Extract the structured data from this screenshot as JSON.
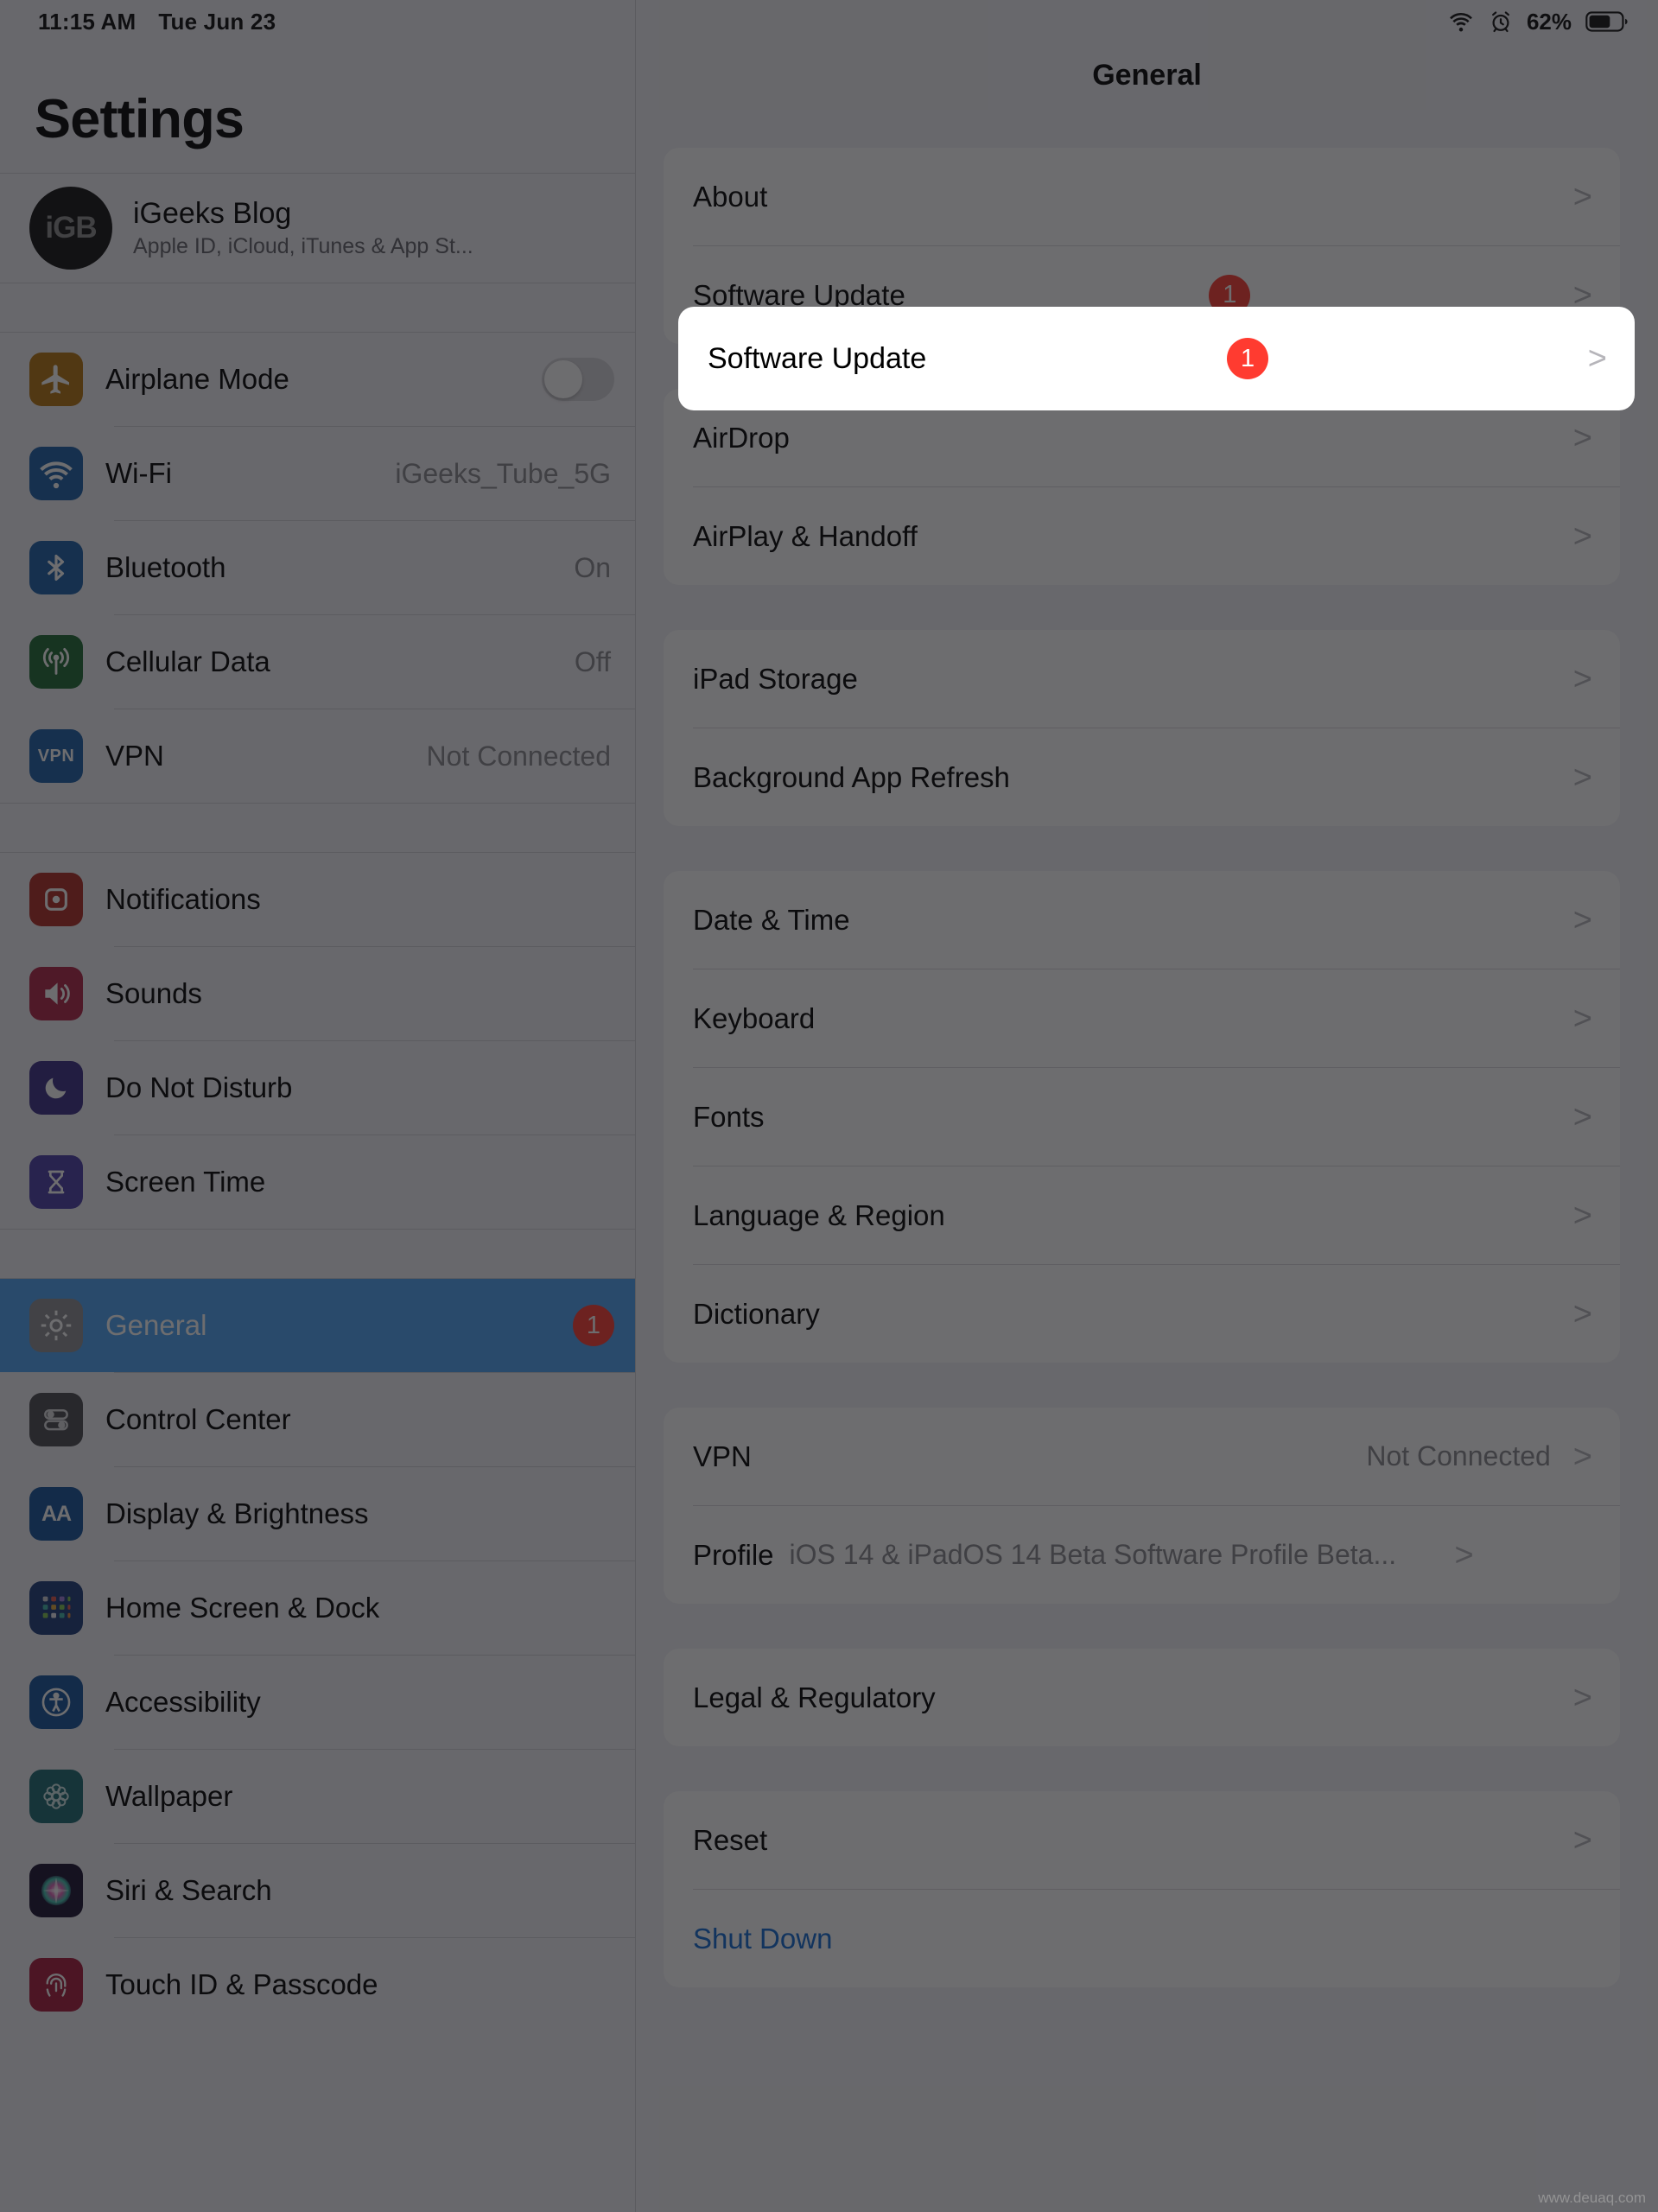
{
  "status_bar": {
    "time": "11:15 AM",
    "date": "Tue Jun 23",
    "wifi_icon": "wifi-icon",
    "alarm_icon": "alarm-clock-icon",
    "battery_percent": "62%",
    "battery_icon": "battery-icon"
  },
  "sidebar": {
    "title": "Settings",
    "account": {
      "avatar_text": "iGB",
      "name": "iGeeks Blog",
      "subtitle": "Apple ID, iCloud, iTunes & App St..."
    },
    "groups": [
      {
        "items": [
          {
            "label": "Airplane Mode",
            "icon": "airplane-icon",
            "icon_color": "#b5730f",
            "control": "toggle",
            "toggle_on": false
          },
          {
            "label": "Wi-Fi",
            "icon": "wifi-icon",
            "icon_color": "#1b5fa8",
            "value": "iGeeks_Tube_5G"
          },
          {
            "label": "Bluetooth",
            "icon": "bluetooth-icon",
            "icon_color": "#1b5fa8",
            "value": "On"
          },
          {
            "label": "Cellular Data",
            "icon": "cellular-icon",
            "icon_color": "#1d6b33",
            "value": "Off"
          },
          {
            "label": "VPN",
            "icon": "vpn-icon",
            "icon_color": "#1b5fa8",
            "value": "Not Connected"
          }
        ]
      },
      {
        "items": [
          {
            "label": "Notifications",
            "icon": "notifications-icon",
            "icon_color": "#b02c24"
          },
          {
            "label": "Sounds",
            "icon": "sounds-icon",
            "icon_color": "#b02446"
          },
          {
            "label": "Do Not Disturb",
            "icon": "moon-icon",
            "icon_color": "#3b2f86"
          },
          {
            "label": "Screen Time",
            "icon": "hourglass-icon",
            "icon_color": "#4b3ea8"
          }
        ]
      },
      {
        "items": [
          {
            "label": "General",
            "icon": "gear-icon",
            "icon_color": "#8e8e93",
            "badge": "1",
            "selected": true
          },
          {
            "label": "Control Center",
            "icon": "control-center-icon",
            "icon_color": "#4a4a4f"
          },
          {
            "label": "Display & Brightness",
            "icon": "display-brightness-icon",
            "icon_color": "#13519b"
          },
          {
            "label": "Home Screen & Dock",
            "icon": "home-screen-dock-icon",
            "icon_color": "#1b3a7a"
          },
          {
            "label": "Accessibility",
            "icon": "accessibility-icon",
            "icon_color": "#13519b"
          },
          {
            "label": "Wallpaper",
            "icon": "wallpaper-icon",
            "icon_color": "#1b6a72"
          },
          {
            "label": "Siri & Search",
            "icon": "siri-icon",
            "icon_color": "#1a1030"
          },
          {
            "label": "Touch ID & Passcode",
            "icon": "touch-id-icon",
            "icon_color": "#a8183a"
          }
        ]
      }
    ]
  },
  "detail": {
    "title": "General",
    "groups": [
      {
        "rows": [
          {
            "label": "About",
            "chevron": ">"
          },
          {
            "label": "Software Update",
            "badge": "1",
            "chevron": ">",
            "highlighted": true
          }
        ]
      },
      {
        "rows": [
          {
            "label": "AirDrop",
            "chevron": ">"
          },
          {
            "label": "AirPlay & Handoff",
            "chevron": ">"
          }
        ]
      },
      {
        "rows": [
          {
            "label": "iPad Storage",
            "chevron": ">"
          },
          {
            "label": "Background App Refresh",
            "chevron": ">"
          }
        ]
      },
      {
        "rows": [
          {
            "label": "Date & Time",
            "chevron": ">"
          },
          {
            "label": "Keyboard",
            "chevron": ">"
          },
          {
            "label": "Fonts",
            "chevron": ">"
          },
          {
            "label": "Language & Region",
            "chevron": ">"
          },
          {
            "label": "Dictionary",
            "chevron": ">"
          }
        ]
      },
      {
        "rows": [
          {
            "label": "VPN",
            "value": "Not Connected",
            "chevron": ">"
          },
          {
            "label": "Profile",
            "value_inline": "iOS 14 & iPadOS 14 Beta Software Profile Beta...",
            "chevron": ">"
          }
        ]
      },
      {
        "rows": [
          {
            "label": "Legal & Regulatory",
            "chevron": ">"
          }
        ]
      },
      {
        "rows": [
          {
            "label": "Reset",
            "chevron": ">"
          },
          {
            "label": "Shut Down",
            "link": true
          }
        ]
      }
    ]
  },
  "spotlight": {
    "label": "Software Update",
    "badge": "1",
    "chevron": ">"
  },
  "watermark": "www.deuaq.com",
  "colors": {
    "accent_blue": "#4da2f5",
    "badge_red": "#ff3b30",
    "link_blue": "#1269d3",
    "panel_bg": "#f2f1f6",
    "card_bg": "#ffffff"
  }
}
